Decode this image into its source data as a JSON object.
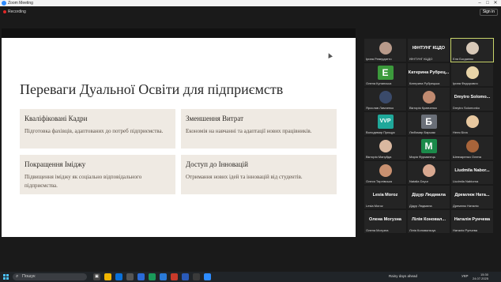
{
  "window": {
    "title": "Zoom Meeting",
    "minimize": "–",
    "maximize": "□",
    "close": "✕"
  },
  "toolbar": {
    "recording_label": "Recording",
    "signin_label": "Sign in"
  },
  "slide": {
    "title": "Переваги Дуальної Освіти для підприємств",
    "cards": [
      {
        "title": "Кваліфіковані Кадри",
        "body": "Підготовка фахівців, адаптованих до потреб підприємства."
      },
      {
        "title": "Зменшення Витрат",
        "body": "Економія на навчанні та адаптації нових працівників."
      },
      {
        "title": "Покращення Іміджу",
        "body": "Підвищення іміджу як соціально відповідального підприємства."
      },
      {
        "title": "Доступ до Інновацій",
        "body": "Отримання нових ідей та інновацій від студентів."
      }
    ]
  },
  "participants": [
    {
      "name": "Ірина Ревердатто",
      "big": "",
      "avatar": "photo",
      "color": "#b89a8a"
    },
    {
      "name": "ІФНТУНГ КЦДО",
      "big": "ІФНТУНГ КЦДО",
      "avatar": "none",
      "color": ""
    },
    {
      "name": "Еля Богданюк",
      "big": "",
      "avatar": "photo",
      "color": "#d8c9b8"
    },
    {
      "name": "Олена Кунанська",
      "big": "",
      "avatar": "letter",
      "letter": "E",
      "color": "#3c9a3c"
    },
    {
      "name": "Катерина Рубрецька",
      "big": "Катерина Рубрец...",
      "avatar": "none",
      "color": ""
    },
    {
      "name": "Ірина Федорович",
      "big": "",
      "avatar": "photo",
      "color": "#e8d4a8"
    },
    {
      "name": "Ярослав Лимченко",
      "big": "",
      "avatar": "photo",
      "color": "#3a4a6a"
    },
    {
      "name": "Вікторія Кравченко",
      "big": "",
      "avatar": "photo",
      "color": "#c08a70"
    },
    {
      "name": "Dmytro Solomonko",
      "big": "Dmytro Solomo...",
      "avatar": "none",
      "color": ""
    },
    {
      "name": "Володимир Прищук",
      "big": "",
      "avatar": "letter",
      "letter": "VVP",
      "color": "#1fa89a"
    },
    {
      "name": "Любомир Баршак",
      "big": "",
      "avatar": "letter",
      "letter": "Б",
      "color": "#6a6f78"
    },
    {
      "name": "Неля Біла",
      "big": "",
      "avatar": "photo",
      "color": "#e8c8a0"
    },
    {
      "name": "Вікторія Мануйда",
      "big": "",
      "avatar": "photo",
      "color": "#d9b8a0"
    },
    {
      "name": "Марія Фурманець",
      "big": "",
      "avatar": "letter",
      "letter": "M",
      "color": "#1b8a4a"
    },
    {
      "name": "Шевчаренко Олена",
      "big": "",
      "avatar": "photo",
      "color": "#a8643a"
    },
    {
      "name": "Олеся Тирлівська",
      "big": "",
      "avatar": "photo",
      "color": "#c89070"
    },
    {
      "name": "Natalia Dzyur",
      "big": "",
      "avatar": "photo",
      "color": "#d8a890"
    },
    {
      "name": "Liudmila Nabiorna",
      "big": "Liudmila Nabor...",
      "avatar": "none",
      "color": ""
    },
    {
      "name": "Lesia Moroz",
      "big": "Lesia Moroz",
      "avatar": "none",
      "color": ""
    },
    {
      "name": "Дідур Людмила",
      "big": "Дідур Людмила",
      "avatar": "none",
      "color": ""
    },
    {
      "name": "Дремлюк Наталія",
      "big": "Дремлюк Ната...",
      "avatar": "none",
      "color": ""
    },
    {
      "name": "Олена Могузна",
      "big": "Олена Могузна",
      "avatar": "none",
      "color": ""
    },
    {
      "name": "Лілія Коновальчук",
      "big": "Лілія Коновал...",
      "avatar": "none",
      "color": ""
    },
    {
      "name": "Наталія Рунчева",
      "big": "Наталія Рунчева",
      "avatar": "none",
      "color": ""
    }
  ],
  "taskbar": {
    "search_placeholder": "Пошук",
    "weather": "Rainy days ahead",
    "lang": "УКР",
    "time": "15:30",
    "date": "24.07.2025"
  }
}
